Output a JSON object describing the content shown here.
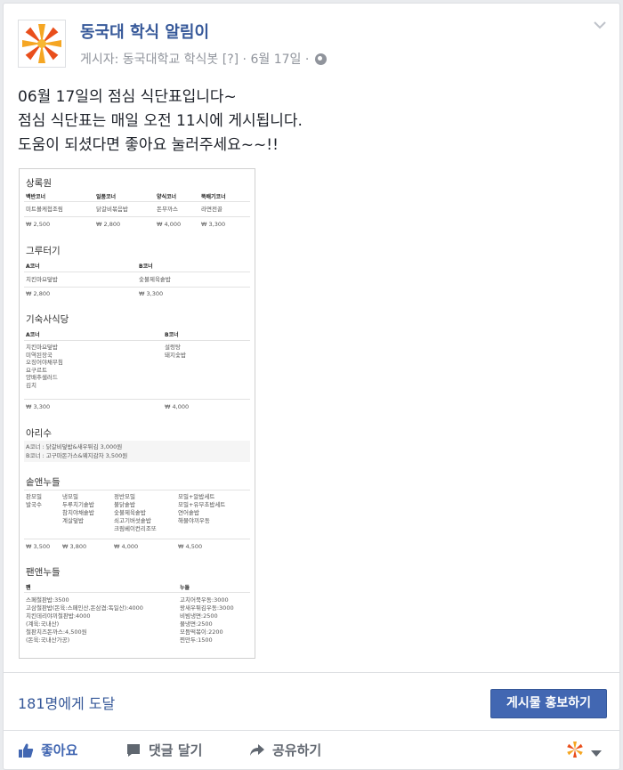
{
  "post": {
    "page_name": "동국대 학식 알림이",
    "meta": "게시자: 동국대학교 학식봇 [?] · 6월 17일 ·",
    "text_lines": [
      "06월 17일의 점심 식단표입니다~",
      "점심 식단표는 매일 오전 11시에 게시됩니다.",
      "도움이 되셨다면 좋아요 눌러주세요~~!!"
    ]
  },
  "menu": {
    "sangrok": {
      "title": "상록원",
      "headers": [
        "백반코너",
        "일품코너",
        "양식코너",
        "뚝배기코너"
      ],
      "items": [
        "미트볼케첩조림",
        "닭갈비볶음밥",
        "돈무까스",
        "라면전골"
      ],
      "prices": [
        "₩ 2,500",
        "₩ 2,800",
        "₩ 4,000",
        "₩ 3,300"
      ]
    },
    "geuru": {
      "title": "그루터기",
      "headers": [
        "A코너",
        "B코너"
      ],
      "items": [
        "치킨마요덮밥",
        "숯불제육솥밥"
      ],
      "prices": [
        "₩ 2,800",
        "₩ 3,300"
      ]
    },
    "dorm": {
      "title": "기숙사식당",
      "headers": [
        "A코너",
        "B코너"
      ],
      "a_items": [
        "치킨마요덮밥",
        "미역된장국",
        "오징어야채무침",
        "요구르트",
        "양배추샐러드",
        "김치"
      ],
      "b_items": [
        "설렁탕",
        "돼지숯밥"
      ],
      "prices": [
        "₩ 3,300",
        "₩ 4,000"
      ]
    },
    "arisu": {
      "title": "아리수",
      "lines": [
        "A코너 : 닭갈비덮밥&새우튀김 3,000원",
        "B코너 : 고구마돈가스&웨지감자 3,500원"
      ]
    },
    "solnoodle": {
      "title": "솥앤누들",
      "col1": [
        "판모밀",
        "발국수"
      ],
      "col2": [
        "냉모밀",
        "두루치기솥밥",
        "참치야채솥밥",
        "계살덮밥"
      ],
      "col3": [
        "정반모밀",
        "불닭솥밥",
        "숯불제육솥밥",
        "쇠고기버섯솥밥",
        "크림베이컨리조또"
      ],
      "col4": [
        "모밀+알밥세트",
        "모밀+유부초밥세트",
        "연어솥밥",
        "해물야끼우동"
      ],
      "prices": [
        "₩ 3,500",
        "₩ 3,800",
        "₩ 4,000",
        "₩ 4,500"
      ]
    },
    "pannoodle": {
      "title": "팬앤누들",
      "headers": [
        "팬",
        "누들"
      ],
      "pan": [
        "스페철판밥:3500",
        "고삼철판밥(돈육:스페인산,돈삼겹:독일산):4000",
        "치킨데리야끼철판밥:4000",
        "(계육:국내산)",
        "철판치즈돈까스:4,500원",
        "(돈육:국내산가공)"
      ],
      "noodle": [
        "고치어묵우동:3000",
        "왕새우튀김우동:3000",
        "비빔냉면:2500",
        "물냉면:2500",
        "모듬떡볶이:2200",
        "찐만두:1500"
      ]
    }
  },
  "footer": {
    "reach": "181명에게 도달",
    "boost_label": "게시물 홍보하기",
    "like_label": "좋아요",
    "comment_label": "댓글 달기",
    "share_label": "공유하기"
  }
}
